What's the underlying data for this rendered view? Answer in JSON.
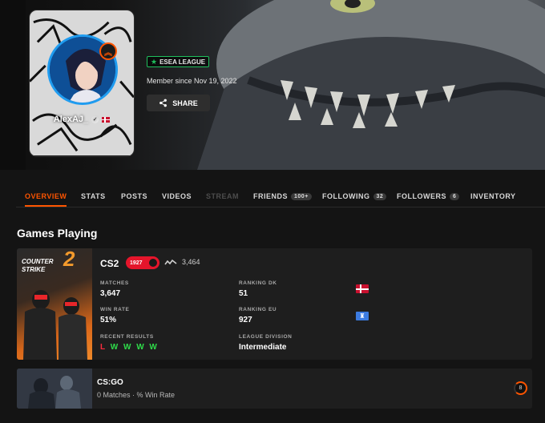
{
  "profile": {
    "nickname": "AlexAJ_",
    "level": "8",
    "badge": "ESEA LEAGUE",
    "member_since": "Member since Nov 19, 2022",
    "share_label": "SHARE"
  },
  "tabs": [
    {
      "label": "OVERVIEW",
      "active": true
    },
    {
      "label": "STATS"
    },
    {
      "label": "POSTS"
    },
    {
      "label": "VIDEOS"
    },
    {
      "label": "STREAM",
      "disabled": true
    },
    {
      "label": "FRIENDS",
      "count": "100+"
    },
    {
      "label": "FOLLOWING",
      "count": "32"
    },
    {
      "label": "FOLLOWERS",
      "count": "6"
    },
    {
      "label": "INVENTORY"
    }
  ],
  "section_title": "Games Playing",
  "cs2": {
    "logo_line1": "COUNTER",
    "logo_line2": "STRIKE",
    "logo_num": "2",
    "title": "CS2",
    "elo": "1927",
    "elo_level": "10",
    "elo_change": "3,464",
    "matches_label": "MATCHES",
    "matches": "3,647",
    "winrate_label": "WIN RATE",
    "winrate": "51%",
    "recent_label": "RECENT RESULTS",
    "recent": [
      "L",
      "W",
      "W",
      "W",
      "W"
    ],
    "rank_dk_label": "RANKING DK",
    "rank_dk": "51",
    "rank_eu_label": "RANKING EU",
    "rank_eu": "927",
    "division_label": "LEAGUE DIVISION",
    "division": "Intermediate"
  },
  "csgo": {
    "title": "CS:GO",
    "subtitle": "0 Matches · % Win Rate",
    "level": "8"
  },
  "colors": {
    "accent": "#ff5500",
    "win": "#2fdc4a",
    "loss": "#ff2b3e",
    "esea": "#1fbf5c"
  }
}
